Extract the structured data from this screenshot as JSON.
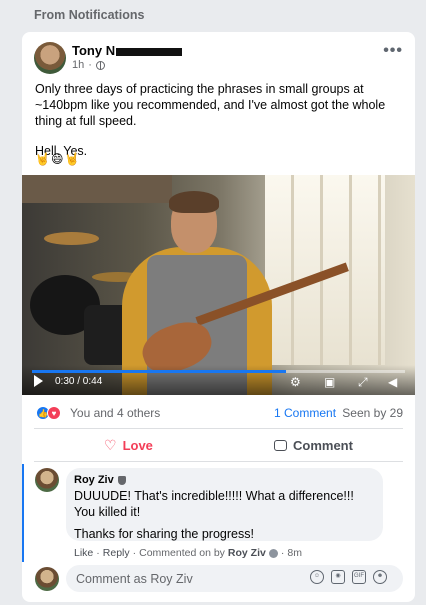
{
  "section_label": "From Notifications",
  "post": {
    "author": "Tony N",
    "time": "1h",
    "body": [
      "Only three days of practicing the phrases in small groups at ~140bpm like you recommended, and I've almost got the whole thing at full speed.",
      "Hell.  Yes."
    ],
    "emoji_line": "🤘😄🤘"
  },
  "video": {
    "current_time": "0:30",
    "duration": "0:44",
    "time_display": "0:30 / 0:44",
    "progress_fraction": 0.68,
    "accent_color": "#1877f2"
  },
  "stats": {
    "reactions_text": "You and 4 others",
    "comment_count": "1 Comment",
    "seen_by": "Seen by 29"
  },
  "actions": {
    "love_label": "Love",
    "comment_label": "Comment"
  },
  "comment": {
    "author": "Roy Ziv",
    "text_1": "DUUUDE! That's incredible!!!!! What a difference!!! You killed it!",
    "text_2": "Thanks for sharing the progress!",
    "meta": {
      "like": "Like",
      "reply": "Reply",
      "commented_on_by": "Commented on by",
      "by_name": "Roy Ziv",
      "time": "8m"
    }
  },
  "composer": {
    "placeholder": "Comment as Roy Ziv"
  },
  "colors": {
    "brand_blue": "#1877f2",
    "love_red": "#f33e58",
    "muted_text": "#65676b"
  }
}
